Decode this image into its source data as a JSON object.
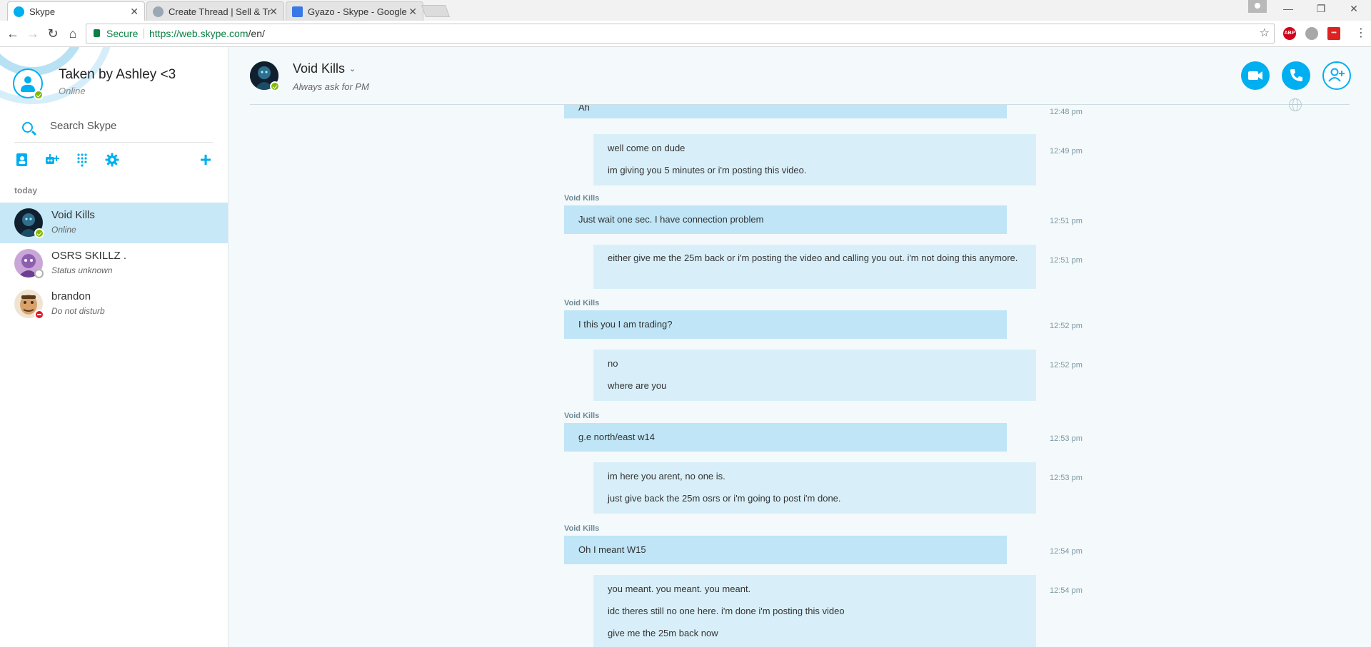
{
  "browser": {
    "tabs": [
      {
        "title": "Skype",
        "active": true
      },
      {
        "title": "Create Thread | Sell & Tr",
        "active": false
      },
      {
        "title": "Gyazo - Skype - Google",
        "active": false
      }
    ],
    "address": {
      "secure_label": "Secure",
      "url_host": "https://web.skype.com",
      "url_path": "/en/"
    },
    "extensions": [
      {
        "name": "adblock-icon",
        "label": "ABP",
        "color": "#d0021b"
      },
      {
        "name": "extension-gray-icon",
        "label": "",
        "color": "#a8a8a8"
      },
      {
        "name": "extension-red-icon",
        "label": "•••",
        "color": "#d22"
      }
    ]
  },
  "profile": {
    "name": "Taken by Ashley <3",
    "status": "Online"
  },
  "search": {
    "placeholder": "Search Skype"
  },
  "sidebar": {
    "section_label": "today",
    "contacts": [
      {
        "name": "Void Kills",
        "status": "Online",
        "presence": "online",
        "selected": true
      },
      {
        "name": "OSRS SKILLZ .",
        "status": "Status unknown",
        "presence": "unknown",
        "selected": false
      },
      {
        "name": "brandon",
        "status": "Do not disturb",
        "presence": "dnd",
        "selected": false
      }
    ]
  },
  "conversation": {
    "title": "Void Kills",
    "subtitle": "Always ask for PM",
    "messages": [
      {
        "sender": "",
        "direction": "in",
        "lines": [
          "Ah"
        ],
        "time": "12:48 pm"
      },
      {
        "sender": "",
        "direction": "out",
        "lines": [
          "well come on dude",
          "im giving you 5 minutes or i'm posting this video."
        ],
        "time": "12:49 pm"
      },
      {
        "sender": "Void Kills",
        "direction": "in",
        "lines": [
          "Just wait one sec. I have connection problem"
        ],
        "time": "12:51 pm"
      },
      {
        "sender": "",
        "direction": "out",
        "lines": [
          "either give me the 25m back or i'm posting the video and calling you out. i'm not doing this anymore."
        ],
        "time": "12:51 pm"
      },
      {
        "sender": "Void Kills",
        "direction": "in",
        "lines": [
          "I this you I am trading?"
        ],
        "time": "12:52 pm"
      },
      {
        "sender": "",
        "direction": "out",
        "lines": [
          "no",
          "where are you"
        ],
        "time": "12:52 pm"
      },
      {
        "sender": "Void Kills",
        "direction": "in",
        "lines": [
          "g.e north/east w14"
        ],
        "time": "12:53 pm"
      },
      {
        "sender": "",
        "direction": "out",
        "lines": [
          "im here you arent, no one is.",
          "just give back the 25m osrs or i'm going to post i'm done."
        ],
        "time": "12:53 pm"
      },
      {
        "sender": "Void Kills",
        "direction": "in",
        "lines": [
          "Oh I meant W15"
        ],
        "time": "12:54 pm"
      },
      {
        "sender": "",
        "direction": "out",
        "lines": [
          "you meant. you meant. you meant.",
          "idc theres still no one here. i'm done i'm posting this video",
          "give me the 25m back now"
        ],
        "time": "12:54 pm"
      }
    ]
  },
  "colors": {
    "accent": "#00aff0",
    "incoming_bubble": "#bfe5f7",
    "outgoing_bubble": "#d8eff9",
    "online": "#7fba00",
    "dnd": "#e81123"
  }
}
